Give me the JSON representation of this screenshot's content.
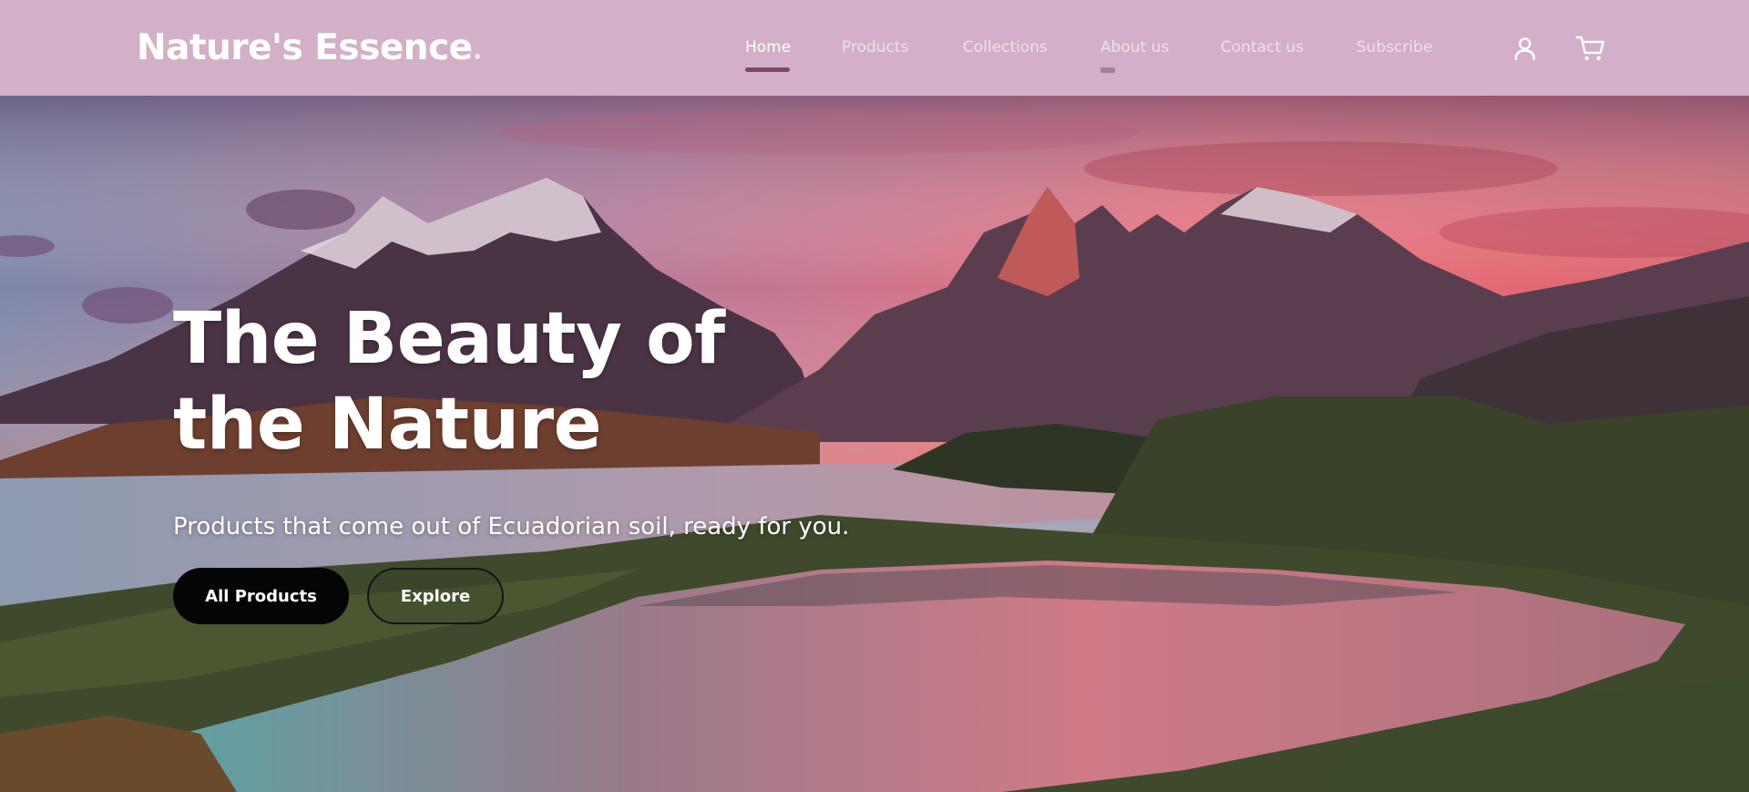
{
  "brand": {
    "name": "Nature's Essence"
  },
  "nav": {
    "items": [
      {
        "label": "Home",
        "active": true
      },
      {
        "label": "Products"
      },
      {
        "label": "Collections"
      },
      {
        "label": "About us"
      },
      {
        "label": "Contact us"
      },
      {
        "label": "Subscribe"
      }
    ],
    "icons": [
      "user-icon",
      "cart-icon"
    ]
  },
  "hero": {
    "title": "The Beauty of the Nature",
    "subtitle": "Products that come out of Ecuadorian soil, ready for you.",
    "primary_button": "All Products",
    "secondary_button": "Explore"
  },
  "colors": {
    "header_bg": "#d3b0c7",
    "active_underline": "#7a4a6a",
    "primary_button_bg": "#050505",
    "text_on_dark": "#ffffff"
  }
}
